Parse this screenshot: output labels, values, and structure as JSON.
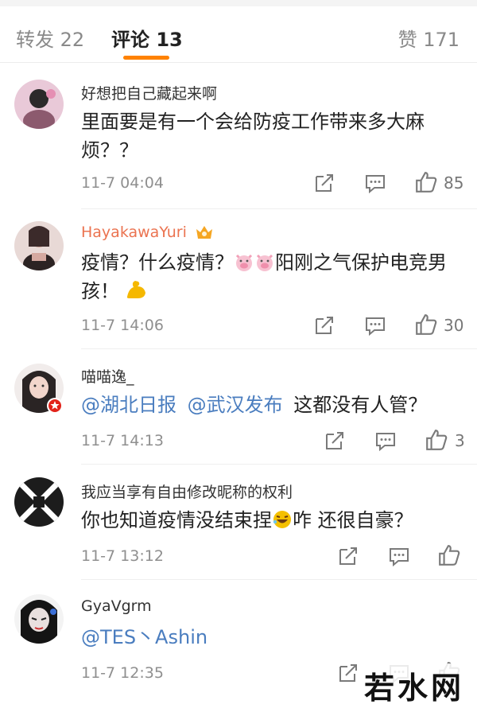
{
  "tabs": {
    "repost": "转发 22",
    "comment": "评论 13",
    "like": "赞 171"
  },
  "comments": [
    {
      "username": "好想把自己藏起来啊",
      "text": "里面要是有一个会给防疫工作带来多大麻烦？？",
      "time": "11-7 04:04",
      "likes": "85"
    },
    {
      "username": "HayakawaYuri",
      "text_a": "疫情？什么疫情？",
      "text_b": "阳刚之气保护电竞男孩！",
      "time": "11-7 14:06",
      "likes": "30"
    },
    {
      "username": "喵喵逸_",
      "mention1": "@湖北日报",
      "mention2": "@武汉发布",
      "text": "这都没有人管？",
      "time": "11-7 14:13",
      "likes": "3"
    },
    {
      "username": "我应当享有自由修改昵称的权利",
      "text_a": "你也知道疫情没结束捏",
      "text_b": "咋 还很自豪？",
      "time": "11-7 13:12",
      "likes": ""
    },
    {
      "username": "GyaVgrm",
      "mention": "@TES丶Ashin",
      "time": "11-7 12:35",
      "likes": ""
    }
  ],
  "watermark": "若水网",
  "colors": {
    "accent": "#ff8200",
    "mention": "#4a7dbf",
    "vip_name": "#eb7350"
  },
  "icons": [
    "share-icon",
    "comment-icon",
    "thumbs-up-icon",
    "vip-crown-icon",
    "pig-emoji-icon",
    "muscle-emoji-icon",
    "laughing-emoji-icon"
  ]
}
